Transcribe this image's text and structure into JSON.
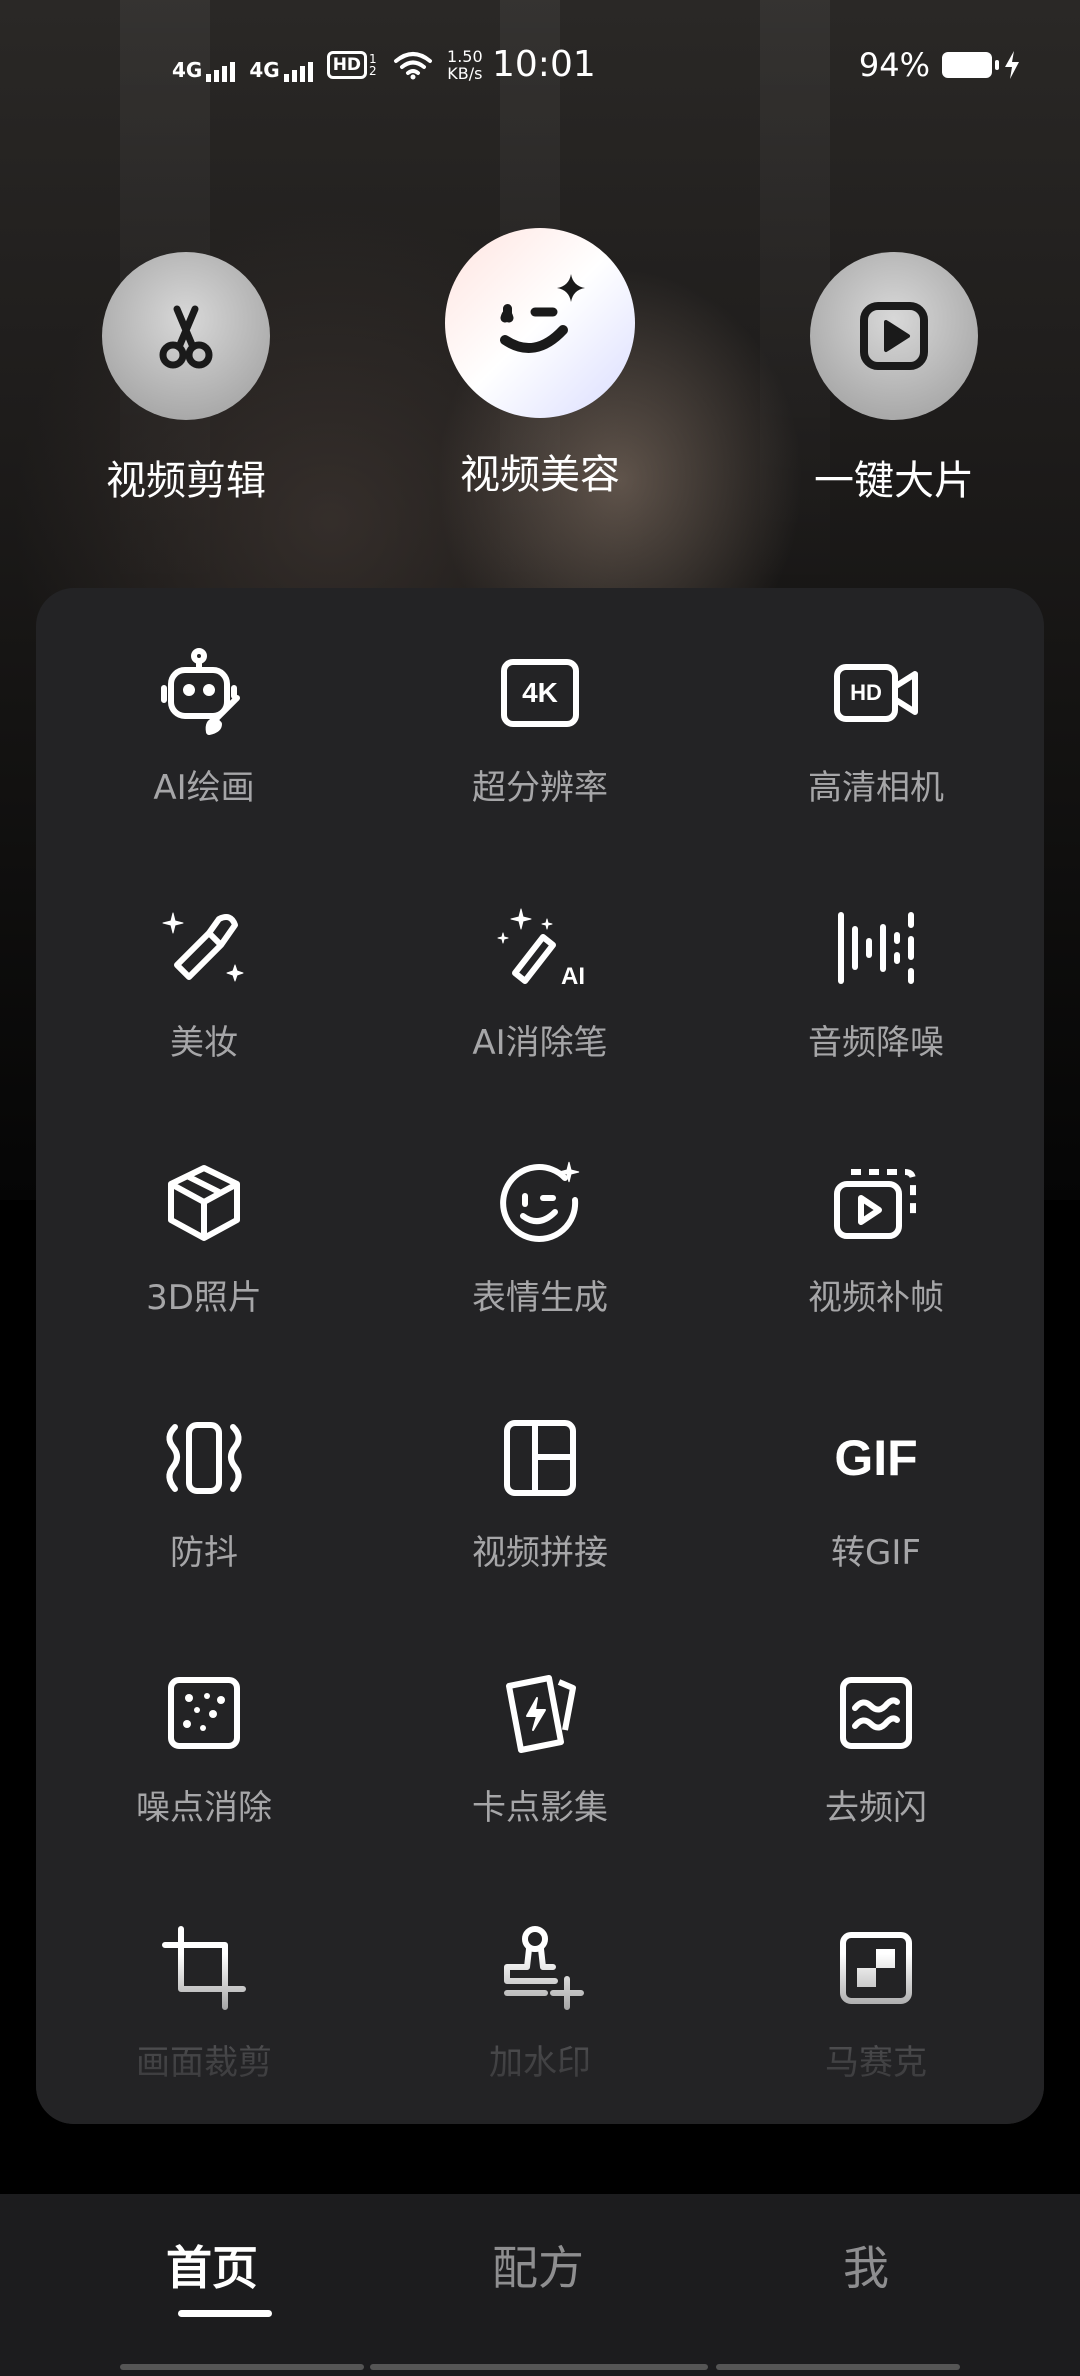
{
  "status_bar": {
    "signal_1": "4G",
    "signal_2": "4G",
    "hd_badge": "HD",
    "hd_sub": "1 2",
    "net_speed_value": "1.50",
    "net_speed_unit": "KB/s",
    "time": "10:01",
    "battery": "94%"
  },
  "top_entries": [
    {
      "label": "视频剪辑",
      "icon": "scissors-icon"
    },
    {
      "label": "视频美容",
      "icon": "wink-face-icon"
    },
    {
      "label": "一键大片",
      "icon": "play-icon"
    }
  ],
  "tools": [
    {
      "label": "AI绘画",
      "icon": "robot-paint-icon"
    },
    {
      "label": "超分辨率",
      "icon": "4k-icon",
      "icon_text": "4K"
    },
    {
      "label": "高清相机",
      "icon": "hd-camera-icon",
      "icon_text": "HD"
    },
    {
      "label": "美妆",
      "icon": "lipstick-icon"
    },
    {
      "label": "AI消除笔",
      "icon": "magic-wand-icon",
      "icon_text": "AI"
    },
    {
      "label": "音频降噪",
      "icon": "audio-wave-icon"
    },
    {
      "label": "3D照片",
      "icon": "cube-icon"
    },
    {
      "label": "表情生成",
      "icon": "smile-sparkle-icon"
    },
    {
      "label": "视频补帧",
      "icon": "video-frames-icon"
    },
    {
      "label": "防抖",
      "icon": "stabilize-icon"
    },
    {
      "label": "视频拼接",
      "icon": "layout-grid-icon"
    },
    {
      "label": "转GIF",
      "icon": "gif-icon",
      "icon_text": "GIF"
    },
    {
      "label": "噪点消除",
      "icon": "dots-square-icon"
    },
    {
      "label": "卡点影集",
      "icon": "flash-card-icon"
    },
    {
      "label": "去频闪",
      "icon": "flicker-wave-icon"
    },
    {
      "label": "画面裁剪",
      "icon": "crop-icon"
    },
    {
      "label": "加水印",
      "icon": "stamp-add-icon"
    },
    {
      "label": "马赛克",
      "icon": "mosaic-icon"
    }
  ],
  "bottom_nav": {
    "tabs": [
      "首页",
      "配方",
      "我"
    ],
    "active": "首页"
  }
}
